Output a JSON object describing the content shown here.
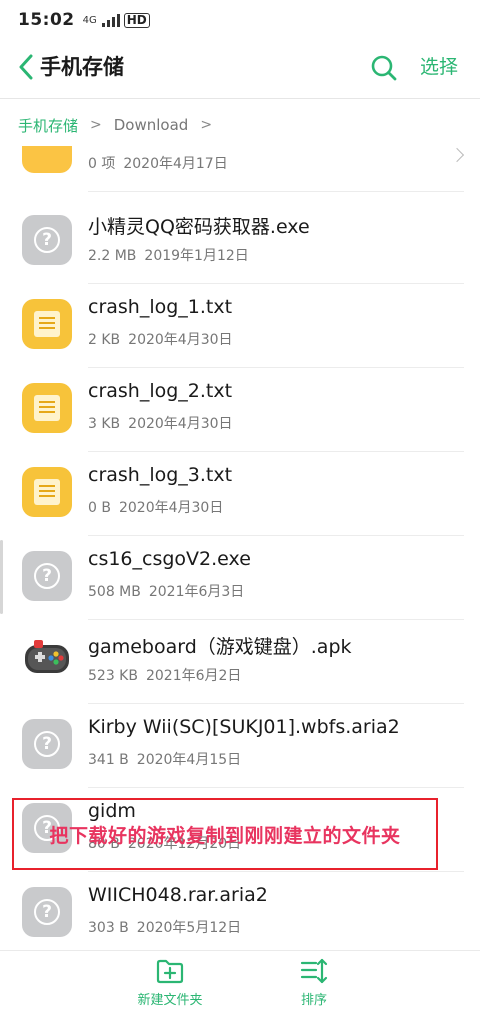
{
  "status_bar": {
    "time": "15:02",
    "network": "4G",
    "hd": "HD"
  },
  "header": {
    "title": "手机存储",
    "select_label": "选择",
    "accent": "#2bb673"
  },
  "breadcrumb": {
    "root": "手机存储",
    "current": "Download"
  },
  "files": [
    {
      "name": "",
      "size": "0 项",
      "date": "2020年4月17日",
      "icon": "folder-icon"
    },
    {
      "name": "小精灵QQ密码获取器.exe",
      "size": "2.2 MB",
      "date": "2019年1月12日",
      "icon": "unknown-file-icon"
    },
    {
      "name": "crash_log_1.txt",
      "size": "2 KB",
      "date": "2020年4月30日",
      "icon": "text-file-icon"
    },
    {
      "name": "crash_log_2.txt",
      "size": "3 KB",
      "date": "2020年4月30日",
      "icon": "text-file-icon"
    },
    {
      "name": "crash_log_3.txt",
      "size": "0 B",
      "date": "2020年4月30日",
      "icon": "text-file-icon"
    },
    {
      "name": "cs16_csgoV2.exe",
      "size": "508 MB",
      "date": "2021年6月3日",
      "icon": "unknown-file-icon"
    },
    {
      "name": "gameboard（游戏键盘）.apk",
      "size": "523 KB",
      "date": "2021年6月2日",
      "icon": "apk-file-icon"
    },
    {
      "name": "Kirby Wii(SC)[SUKJ01].wbfs.aria2",
      "size": "341 B",
      "date": "2020年4月15日",
      "icon": "unknown-file-icon"
    },
    {
      "name": "gidm",
      "size": "80 B",
      "date": "2020年12月20日",
      "icon": "unknown-file-icon"
    },
    {
      "name": "WIICH048.rar.aria2",
      "size": "303 B",
      "date": "2020年5月12日",
      "icon": "unknown-file-icon"
    }
  ],
  "annotation": {
    "text": "把下载好的游戏复制到刚刚建立的文件夹",
    "color": "#e8212c"
  },
  "bottom_bar": {
    "new_folder_label": "新建文件夹",
    "sort_label": "排序"
  }
}
